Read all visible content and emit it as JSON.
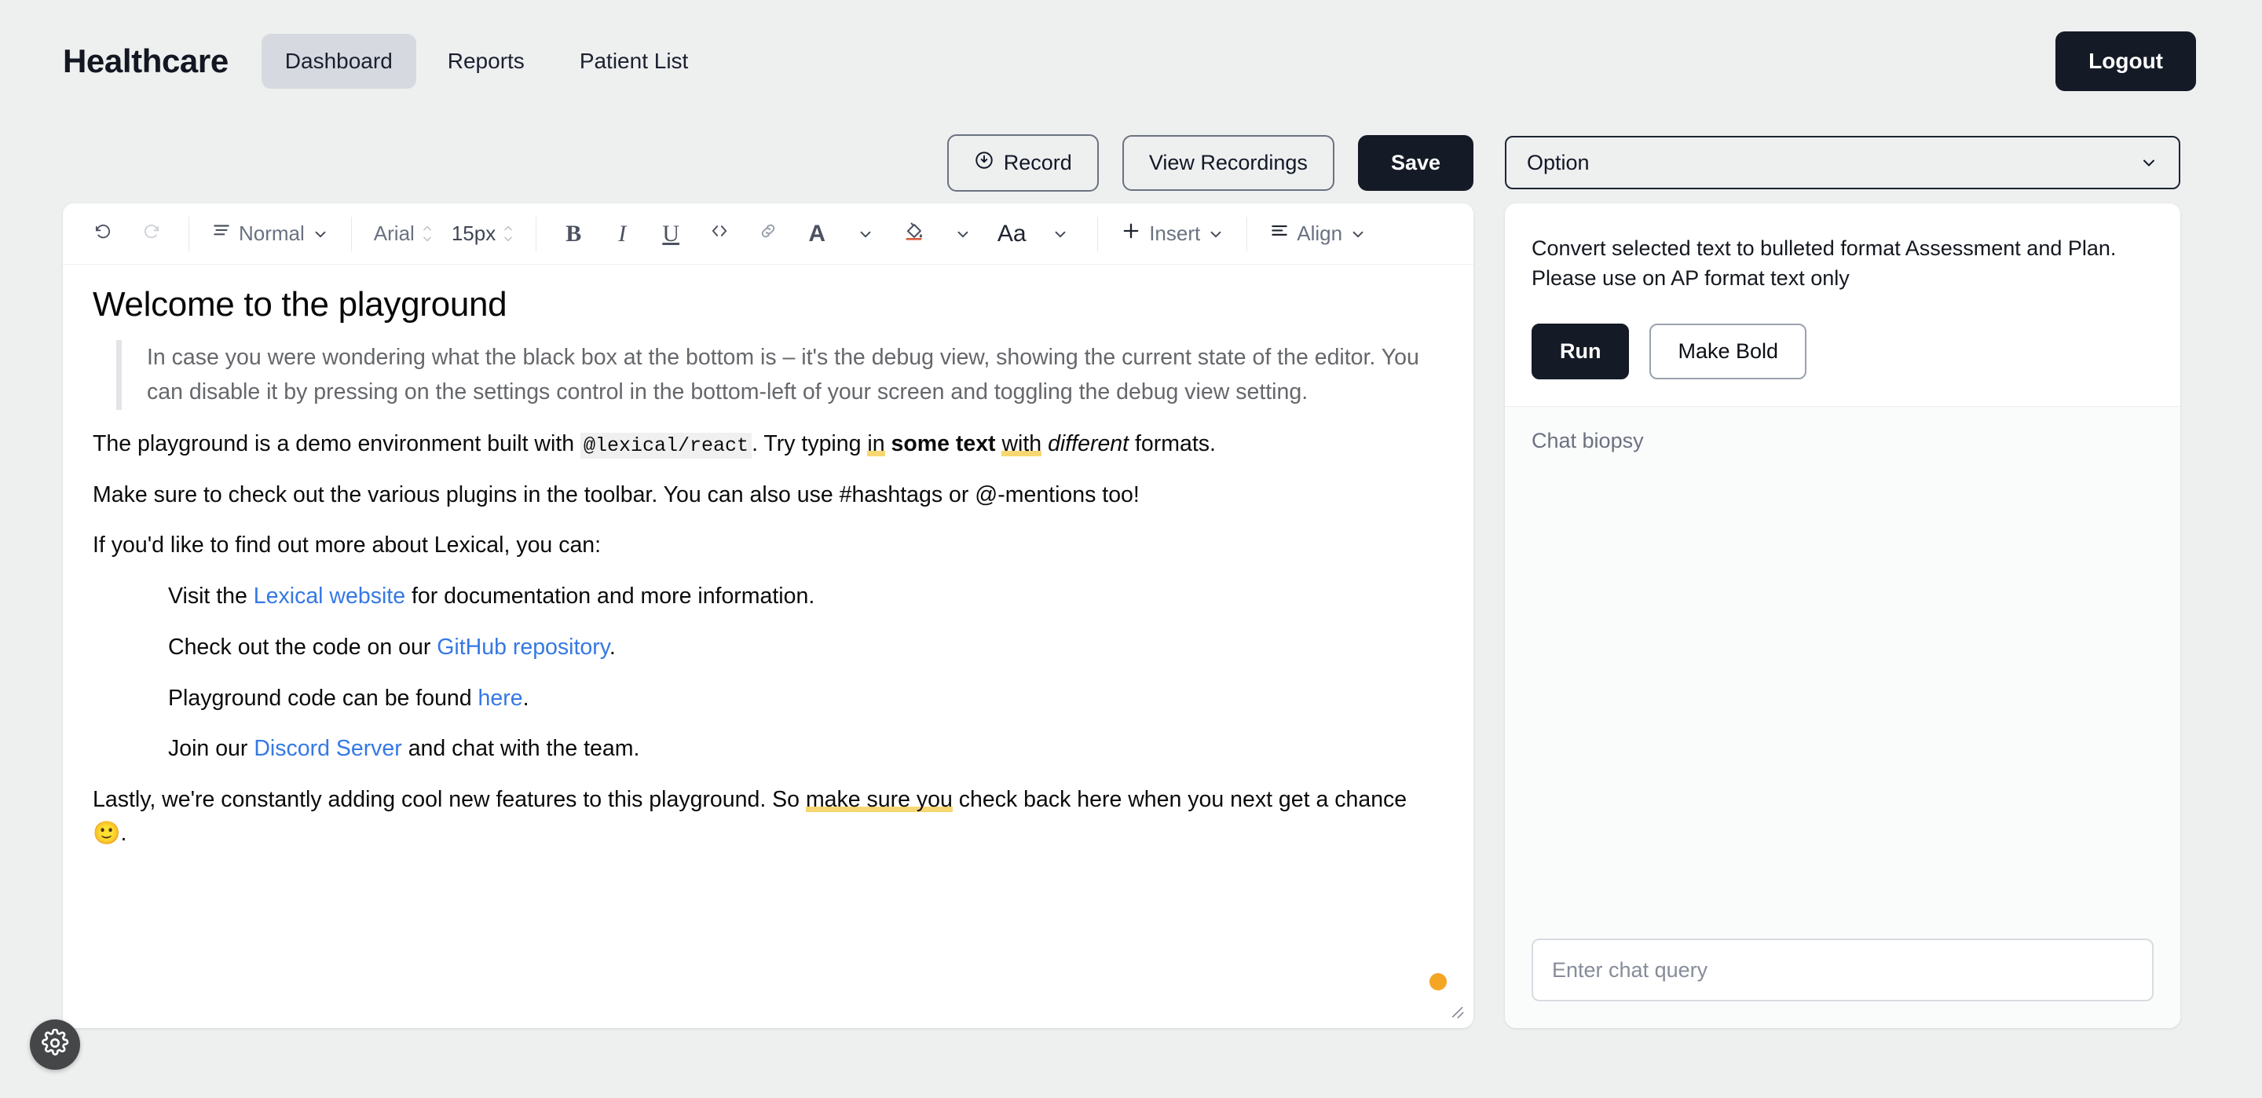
{
  "header": {
    "brand": "Healthcare",
    "nav": [
      {
        "label": "Dashboard",
        "active": true
      },
      {
        "label": "Reports",
        "active": false
      },
      {
        "label": "Patient List",
        "active": false
      }
    ],
    "logout_label": "Logout"
  },
  "actions": {
    "record_label": "Record",
    "record_icon": "record-circle-icon",
    "view_recordings_label": "View Recordings",
    "save_label": "Save"
  },
  "toolbar": {
    "undo_icon": "undo-icon",
    "redo_icon": "redo-icon",
    "block_icon": "paragraph-icon",
    "block_format": "Normal",
    "font_family": "Arial",
    "font_size": "15px",
    "bold": "B",
    "italic": "I",
    "underline": "U",
    "code_icon": "code-brackets-icon",
    "link_icon": "link-chain-icon",
    "text_color": "A",
    "bg_color_icon": "fill-bucket-icon",
    "text_case": "Aa",
    "insert_label": "Insert",
    "insert_icon": "plus-icon",
    "align_label": "Align",
    "align_icon": "align-left-icon",
    "chevron_icon": "chevron-down-icon"
  },
  "document": {
    "heading": "Welcome to the playground",
    "quote": "In case you were wondering what the black box at the bottom is – it's the debug view, showing the current state of the editor. You can disable it by pressing on the settings control in the bottom-left of your screen and toggling the debug view setting.",
    "para1": {
      "before_code": "The playground is a demo environment built with ",
      "code": "@lexical/react",
      "after_code": ". Try typing ",
      "hl1": "in",
      "mid1": " ",
      "bold": "some text",
      "mid2": " ",
      "hl2": "with",
      "mid3": " ",
      "italic": "different",
      "tail": " formats."
    },
    "para2": "Make sure to check out the various plugins in the toolbar. You can also use #hashtags or @-mentions too!",
    "para3": "If you'd like to find out more about Lexical, you can:",
    "items": [
      {
        "pre": "Visit the ",
        "link": "Lexical website",
        "post": " for documentation and more information."
      },
      {
        "pre": "Check out the code on our ",
        "link": "GitHub repository",
        "post": "."
      },
      {
        "pre": "Playground code can be found ",
        "link": "here",
        "post": "."
      },
      {
        "pre": "Join our ",
        "link": "Discord Server",
        "post": " and chat with the team."
      }
    ],
    "para4": {
      "pre": "Lastly, we're constantly adding cool new features to this playground. So ",
      "hl": "make sure you",
      "post": " check back here when you next get a chance 🙂."
    },
    "marker_color": "#f5a524",
    "highlight_color": "#f7d772",
    "link_color": "#3578e5"
  },
  "right_panel": {
    "select_value": "Option",
    "description": "Convert selected text to bulleted format Assessment and Plan. Please use on AP format text only",
    "run_label": "Run",
    "make_bold_label": "Make Bold",
    "chat_label": "Chat biopsy",
    "chat_placeholder": "Enter chat query"
  },
  "settings": {
    "icon": "gear-icon"
  }
}
